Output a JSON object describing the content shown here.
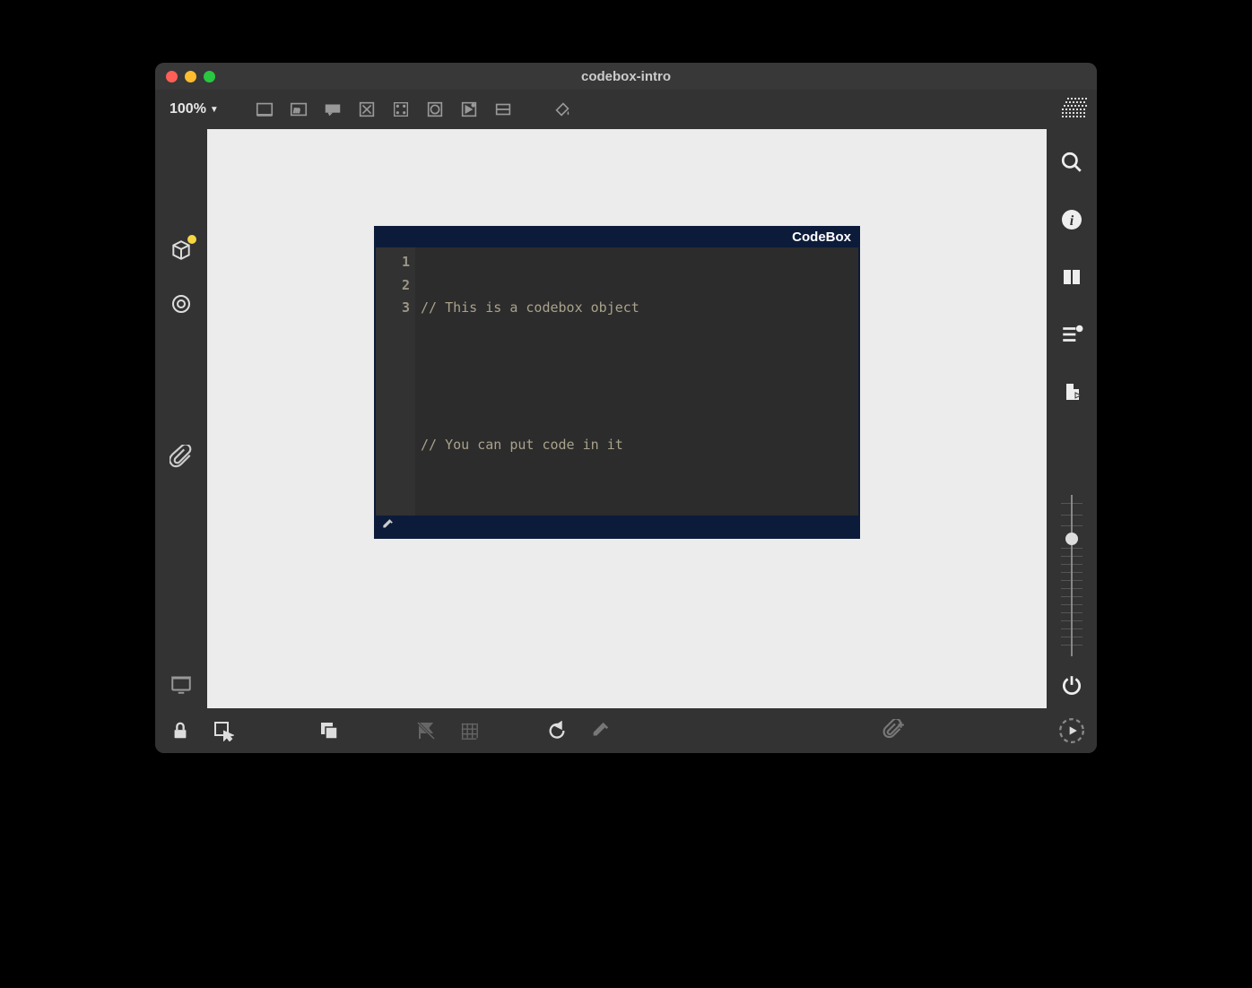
{
  "window": {
    "title": "codebox-intro"
  },
  "toolbar": {
    "zoom": "100%"
  },
  "codebox": {
    "title": "CodeBox",
    "gutter": [
      "1",
      "2",
      "3"
    ],
    "lines": [
      "// This is a codebox object",
      "",
      "// You can put code in it"
    ]
  }
}
